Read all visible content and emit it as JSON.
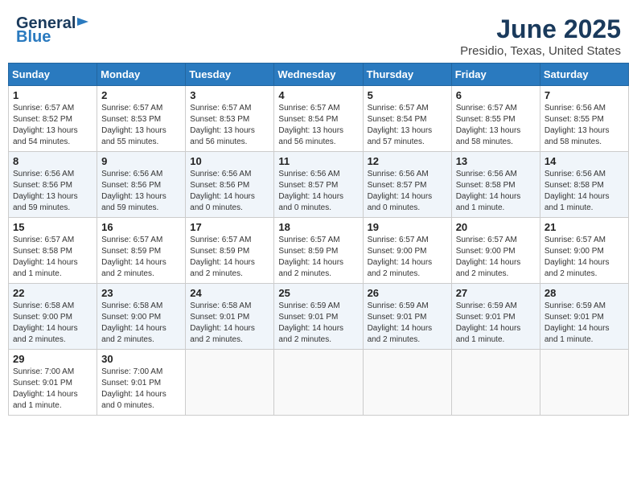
{
  "header": {
    "logo_general": "General",
    "logo_blue": "Blue",
    "month": "June 2025",
    "location": "Presidio, Texas, United States"
  },
  "weekdays": [
    "Sunday",
    "Monday",
    "Tuesday",
    "Wednesday",
    "Thursday",
    "Friday",
    "Saturday"
  ],
  "weeks": [
    [
      {
        "day": "1",
        "info": "Sunrise: 6:57 AM\nSunset: 8:52 PM\nDaylight: 13 hours\nand 54 minutes."
      },
      {
        "day": "2",
        "info": "Sunrise: 6:57 AM\nSunset: 8:53 PM\nDaylight: 13 hours\nand 55 minutes."
      },
      {
        "day": "3",
        "info": "Sunrise: 6:57 AM\nSunset: 8:53 PM\nDaylight: 13 hours\nand 56 minutes."
      },
      {
        "day": "4",
        "info": "Sunrise: 6:57 AM\nSunset: 8:54 PM\nDaylight: 13 hours\nand 56 minutes."
      },
      {
        "day": "5",
        "info": "Sunrise: 6:57 AM\nSunset: 8:54 PM\nDaylight: 13 hours\nand 57 minutes."
      },
      {
        "day": "6",
        "info": "Sunrise: 6:57 AM\nSunset: 8:55 PM\nDaylight: 13 hours\nand 58 minutes."
      },
      {
        "day": "7",
        "info": "Sunrise: 6:56 AM\nSunset: 8:55 PM\nDaylight: 13 hours\nand 58 minutes."
      }
    ],
    [
      {
        "day": "8",
        "info": "Sunrise: 6:56 AM\nSunset: 8:56 PM\nDaylight: 13 hours\nand 59 minutes."
      },
      {
        "day": "9",
        "info": "Sunrise: 6:56 AM\nSunset: 8:56 PM\nDaylight: 13 hours\nand 59 minutes."
      },
      {
        "day": "10",
        "info": "Sunrise: 6:56 AM\nSunset: 8:56 PM\nDaylight: 14 hours\nand 0 minutes."
      },
      {
        "day": "11",
        "info": "Sunrise: 6:56 AM\nSunset: 8:57 PM\nDaylight: 14 hours\nand 0 minutes."
      },
      {
        "day": "12",
        "info": "Sunrise: 6:56 AM\nSunset: 8:57 PM\nDaylight: 14 hours\nand 0 minutes."
      },
      {
        "day": "13",
        "info": "Sunrise: 6:56 AM\nSunset: 8:58 PM\nDaylight: 14 hours\nand 1 minute."
      },
      {
        "day": "14",
        "info": "Sunrise: 6:56 AM\nSunset: 8:58 PM\nDaylight: 14 hours\nand 1 minute."
      }
    ],
    [
      {
        "day": "15",
        "info": "Sunrise: 6:57 AM\nSunset: 8:58 PM\nDaylight: 14 hours\nand 1 minute."
      },
      {
        "day": "16",
        "info": "Sunrise: 6:57 AM\nSunset: 8:59 PM\nDaylight: 14 hours\nand 2 minutes."
      },
      {
        "day": "17",
        "info": "Sunrise: 6:57 AM\nSunset: 8:59 PM\nDaylight: 14 hours\nand 2 minutes."
      },
      {
        "day": "18",
        "info": "Sunrise: 6:57 AM\nSunset: 8:59 PM\nDaylight: 14 hours\nand 2 minutes."
      },
      {
        "day": "19",
        "info": "Sunrise: 6:57 AM\nSunset: 9:00 PM\nDaylight: 14 hours\nand 2 minutes."
      },
      {
        "day": "20",
        "info": "Sunrise: 6:57 AM\nSunset: 9:00 PM\nDaylight: 14 hours\nand 2 minutes."
      },
      {
        "day": "21",
        "info": "Sunrise: 6:57 AM\nSunset: 9:00 PM\nDaylight: 14 hours\nand 2 minutes."
      }
    ],
    [
      {
        "day": "22",
        "info": "Sunrise: 6:58 AM\nSunset: 9:00 PM\nDaylight: 14 hours\nand 2 minutes."
      },
      {
        "day": "23",
        "info": "Sunrise: 6:58 AM\nSunset: 9:00 PM\nDaylight: 14 hours\nand 2 minutes."
      },
      {
        "day": "24",
        "info": "Sunrise: 6:58 AM\nSunset: 9:01 PM\nDaylight: 14 hours\nand 2 minutes."
      },
      {
        "day": "25",
        "info": "Sunrise: 6:59 AM\nSunset: 9:01 PM\nDaylight: 14 hours\nand 2 minutes."
      },
      {
        "day": "26",
        "info": "Sunrise: 6:59 AM\nSunset: 9:01 PM\nDaylight: 14 hours\nand 2 minutes."
      },
      {
        "day": "27",
        "info": "Sunrise: 6:59 AM\nSunset: 9:01 PM\nDaylight: 14 hours\nand 1 minute."
      },
      {
        "day": "28",
        "info": "Sunrise: 6:59 AM\nSunset: 9:01 PM\nDaylight: 14 hours\nand 1 minute."
      }
    ],
    [
      {
        "day": "29",
        "info": "Sunrise: 7:00 AM\nSunset: 9:01 PM\nDaylight: 14 hours\nand 1 minute."
      },
      {
        "day": "30",
        "info": "Sunrise: 7:00 AM\nSunset: 9:01 PM\nDaylight: 14 hours\nand 0 minutes."
      },
      {
        "day": "",
        "info": ""
      },
      {
        "day": "",
        "info": ""
      },
      {
        "day": "",
        "info": ""
      },
      {
        "day": "",
        "info": ""
      },
      {
        "day": "",
        "info": ""
      }
    ]
  ]
}
